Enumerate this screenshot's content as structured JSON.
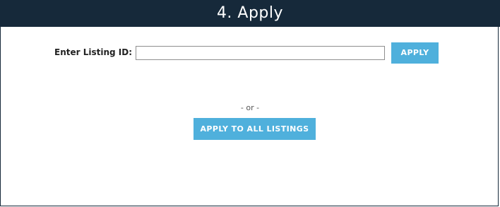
{
  "header": {
    "title": "4. Apply"
  },
  "listing": {
    "label": "Enter Listing ID:",
    "input_value": "",
    "input_placeholder": "",
    "apply_label": "APPLY"
  },
  "separator": {
    "text": "- or -"
  },
  "apply_all": {
    "label": "APPLY TO ALL LISTINGS"
  },
  "colors": {
    "header_bg": "#16293a",
    "button_bg": "#4fb0dc",
    "button_text": "#ffffff"
  }
}
